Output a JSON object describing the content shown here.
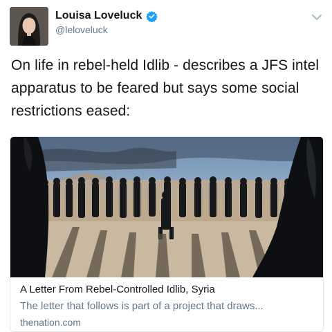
{
  "tweet": {
    "author_name": "Louisa Loveluck",
    "author_handle": "@leloveluck",
    "verified": true,
    "text": "On life in rebel-held Idlib - describes a JFS intel apparatus to be feared but says some social restrictions eased:"
  },
  "card": {
    "title": "A Letter From Rebel-Controlled Idlib, Syria",
    "description": "The letter that follows is part of a project that draws...",
    "domain": "thenation.com"
  },
  "icons": {
    "verified": "verified-badge-icon",
    "menu": "chevron-down-icon"
  },
  "colors": {
    "verified_blue": "#1da1f2",
    "secondary_text": "#657786",
    "border": "#e1e8ed"
  }
}
